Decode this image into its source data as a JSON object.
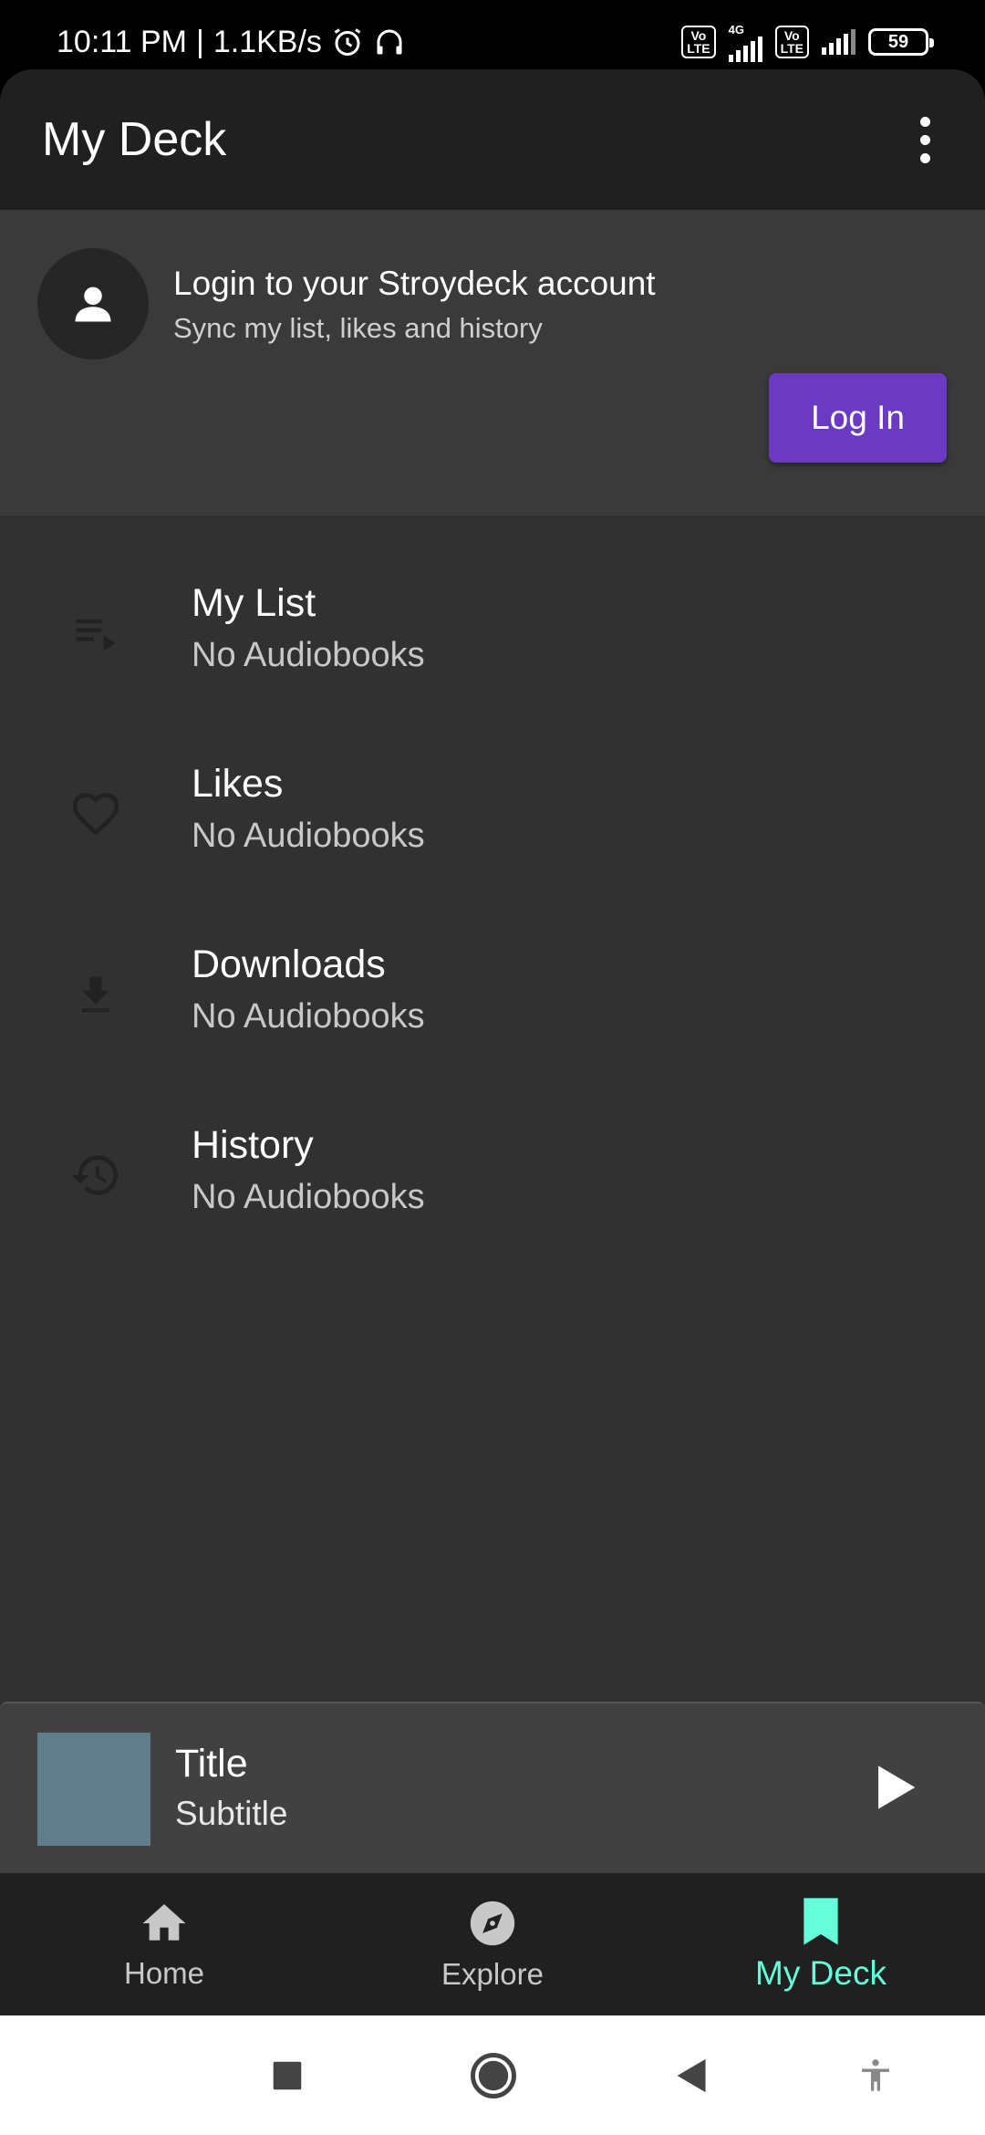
{
  "status_bar": {
    "time": "10:11 PM",
    "separator": "|",
    "net_speed": "1.1KB/s",
    "volte1": "Vo\nLTE",
    "net_type": "4G",
    "volte2": "Vo\nLTE",
    "battery": "59"
  },
  "header": {
    "title": "My Deck"
  },
  "login_card": {
    "title": "Login to your Stroydeck account",
    "subtitle": "Sync my list, likes and history",
    "button_label": "Log In"
  },
  "deck_items": [
    {
      "label": "My List",
      "subtitle": "No Audiobooks",
      "icon": "playlist-play-icon"
    },
    {
      "label": "Likes",
      "subtitle": "No Audiobooks",
      "icon": "heart-outline-icon"
    },
    {
      "label": "Downloads",
      "subtitle": "No Audiobooks",
      "icon": "download-icon"
    },
    {
      "label": "History",
      "subtitle": "No Audiobooks",
      "icon": "history-icon"
    }
  ],
  "mini_player": {
    "title": "Title",
    "subtitle": "Subtitle"
  },
  "bottom_nav": [
    {
      "label": "Home",
      "icon": "home-icon",
      "active": false
    },
    {
      "label": "Explore",
      "icon": "compass-icon",
      "active": false
    },
    {
      "label": "My Deck",
      "icon": "bookmark-icon",
      "active": true
    }
  ],
  "colors": {
    "accent": "#64ffda",
    "login_button": "#6a3ac2",
    "background": "#313131",
    "appbar": "#202020",
    "cover_placeholder": "#607d8b"
  }
}
